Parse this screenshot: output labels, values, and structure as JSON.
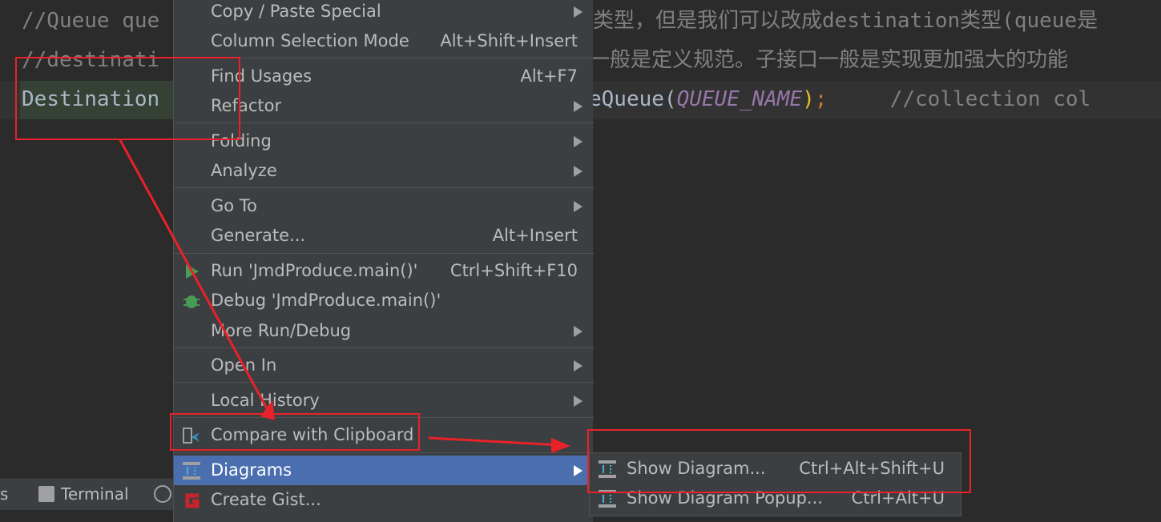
{
  "editor": {
    "line1_left": "//Queue que",
    "line1_right": "类型，但是我们可以改成destination类型(queue是",
    "line2_left": "//destinati",
    "line2_right": "一般是定义规范。子接口一般是实现更加强大的功能",
    "line3_left": "Destination",
    "line3_call": "eQueue(",
    "line3_const": "QUEUE_NAME",
    "line3_close": ")",
    "line3_semi": ";",
    "line3_comment": "     //collection col"
  },
  "context_menu": {
    "items": [
      {
        "label": "Copy / Paste Special",
        "submenu": true
      },
      {
        "label": "Column Selection Mode",
        "shortcut": "Alt+Shift+Insert"
      },
      {
        "label": "Find Usages",
        "shortcut": "Alt+F7"
      },
      {
        "label": "Refactor",
        "submenu": true
      },
      {
        "label": "Folding",
        "submenu": true
      },
      {
        "label": "Analyze",
        "submenu": true
      },
      {
        "label": "Go To",
        "submenu": true
      },
      {
        "label": "Generate...",
        "shortcut": "Alt+Insert"
      },
      {
        "label": "Run 'JmdProduce.main()'",
        "shortcut": "Ctrl+Shift+F10",
        "icon": "run-icon"
      },
      {
        "label": "Debug 'JmdProduce.main()'",
        "icon": "debug-icon"
      },
      {
        "label": "More Run/Debug",
        "submenu": true
      },
      {
        "label": "Open In",
        "submenu": true
      },
      {
        "label": "Local History",
        "submenu": true
      },
      {
        "label": "Compare with Clipboard",
        "icon": "compare-clipboard-icon"
      },
      {
        "label": "Diagrams",
        "submenu": true,
        "icon": "diagram-icon",
        "active": true
      },
      {
        "label": "Create Gist...",
        "icon": "gist-icon"
      }
    ]
  },
  "diagrams_submenu": {
    "items": [
      {
        "label": "Show Diagram...",
        "shortcut": "Ctrl+Alt+Shift+U"
      },
      {
        "label": "Show Diagram Popup...",
        "shortcut": "Ctrl+Alt+U"
      }
    ]
  },
  "statusbar": {
    "partial": "s",
    "terminal": "Terminal"
  },
  "colors": {
    "accent": "#4b6eaf",
    "annotation": "#e8222a",
    "menu_bg": "#3c3f41",
    "editor_bg": "#2b2b2b"
  }
}
